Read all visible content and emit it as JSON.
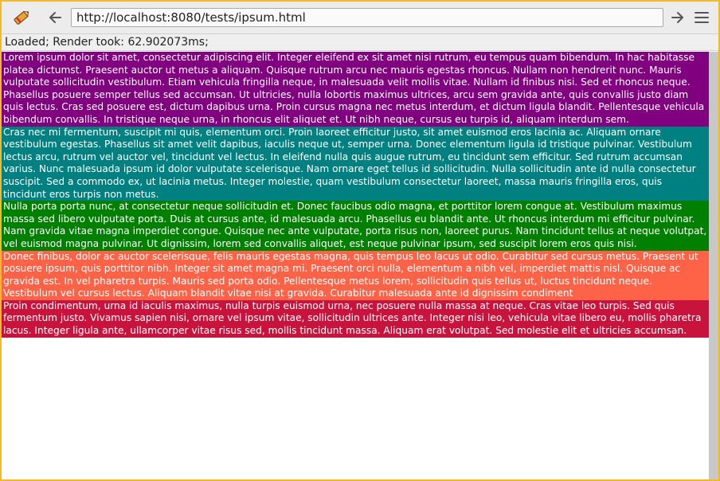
{
  "browser": {
    "url": "http://localhost:8080/tests/ipsum.html",
    "status": "Loaded; Render took: 62.902073ms;",
    "icons": {
      "app": "pen-icon",
      "back": "back-arrow-icon",
      "forward": "forward-arrow-icon",
      "menu": "hamburger-menu-icon"
    },
    "colors": {
      "frame_border": "#f2b92a",
      "toolbar": "#ececec",
      "scrollbar": "#c8c8c8"
    }
  },
  "page": {
    "paragraphs": [
      {
        "bg": "#800080",
        "text": "Lorem ipsum dolor sit amet, consectetur adipiscing elit. Integer eleifend ex sit amet nisi rutrum, eu tempus quam bibendum. In hac habitasse platea dictumst. Praesent auctor ut metus a aliquam. Quisque rutrum arcu nec mauris egestas rhoncus. Nullam non hendrerit nunc. Mauris vulputate sollicitudin vestibulum. Etiam vehicula fringilla neque, in malesuada velit mollis vitae. Nullam id finibus nisi. Sed et rhoncus neque. Phasellus posuere semper tellus sed accumsan. Ut ultricies, nulla lobortis maximus ultrices, arcu sem gravida ante, quis convallis justo diam quis lectus. Cras sed posuere est, dictum dapibus urna. Proin cursus magna nec metus interdum, et dictum ligula blandit. Pellentesque vehicula bibendum convallis. In tristique neque urna, in rhoncus elit aliquet et. Ut nibh neque, cursus eu turpis id, aliquam interdum sem."
      },
      {
        "bg": "#008080",
        "text": "Cras nec mi fermentum, suscipit mi quis, elementum orci. Proin laoreet efficitur justo, sit amet euismod eros lacinia ac. Aliquam ornare vestibulum egestas. Phasellus sit amet velit dapibus, iaculis neque ut, semper urna. Donec elementum ligula id tristique pulvinar. Vestibulum lectus arcu, rutrum vel auctor vel, tincidunt vel lectus. In eleifend nulla quis augue rutrum, eu tincidunt sem efficitur. Sed rutrum accumsan varius. Nunc malesuada ipsum id dolor vulputate scelerisque. Nam ornare eget tellus id sollicitudin. Nulla sollicitudin ante id nulla consectetur suscipit. Sed a commodo ex, ut lacinia metus. Integer molestie, quam vestibulum consectetur laoreet, massa mauris fringilla eros, quis tincidunt eros turpis non metus."
      },
      {
        "bg": "#008000",
        "text": "Nulla porta porta nunc, at consectetur neque sollicitudin et. Donec faucibus odio magna, et porttitor lorem congue at. Vestibulum maximus massa sed libero vulputate porta. Duis at cursus ante, id malesuada arcu. Phasellus eu blandit ante. Ut rhoncus interdum mi efficitur pulvinar. Nam gravida vitae magna imperdiet congue. Quisque nec ante vulputate, porta risus non, laoreet purus. Nam tincidunt tellus at neque volutpat, vel euismod magna pulvinar. Ut dignissim, lorem sed convallis aliquet, est neque pulvinar ipsum, sed suscipit lorem eros quis nisi."
      },
      {
        "bg": "#ff6347",
        "text": "Donec finibus, dolor ac auctor scelerisque, felis mauris egestas magna, quis tempus leo lacus ut odio. Curabitur sed cursus metus. Praesent ut posuere ipsum, quis porttitor nibh. Integer sit amet magna mi. Praesent orci nulla, elementum a nibh vel, imperdiet mattis nisl. Quisque ac gravida est. In vel pharetra turpis. Mauris sed porta odio. Pellentesque metus lorem, sollicitudin quis tellus ut, luctus tincidunt neque. Vestibulum vel cursus lectus. Aliquam blandit vitae nisi at gravida. Curabitur malesuada ante id dignissim condiment"
      },
      {
        "bg": "#c8143c",
        "text": "Proin condimentum, urna id iaculis maximus, nulla turpis euismod urna, nec posuere nulla massa at neque. Cras vitae leo turpis. Sed quis fermentum justo. Vivamus sapien nisi, ornare vel ipsum vitae, sollicitudin ultrices ante. Integer nisi leo, vehicula vitae libero eu, mollis pharetra lacus. Integer ligula ante, ullamcorper vitae risus sed, mollis tincidunt massa. Aliquam erat volutpat. Sed molestie elit et ultricies accumsan."
      }
    ]
  }
}
